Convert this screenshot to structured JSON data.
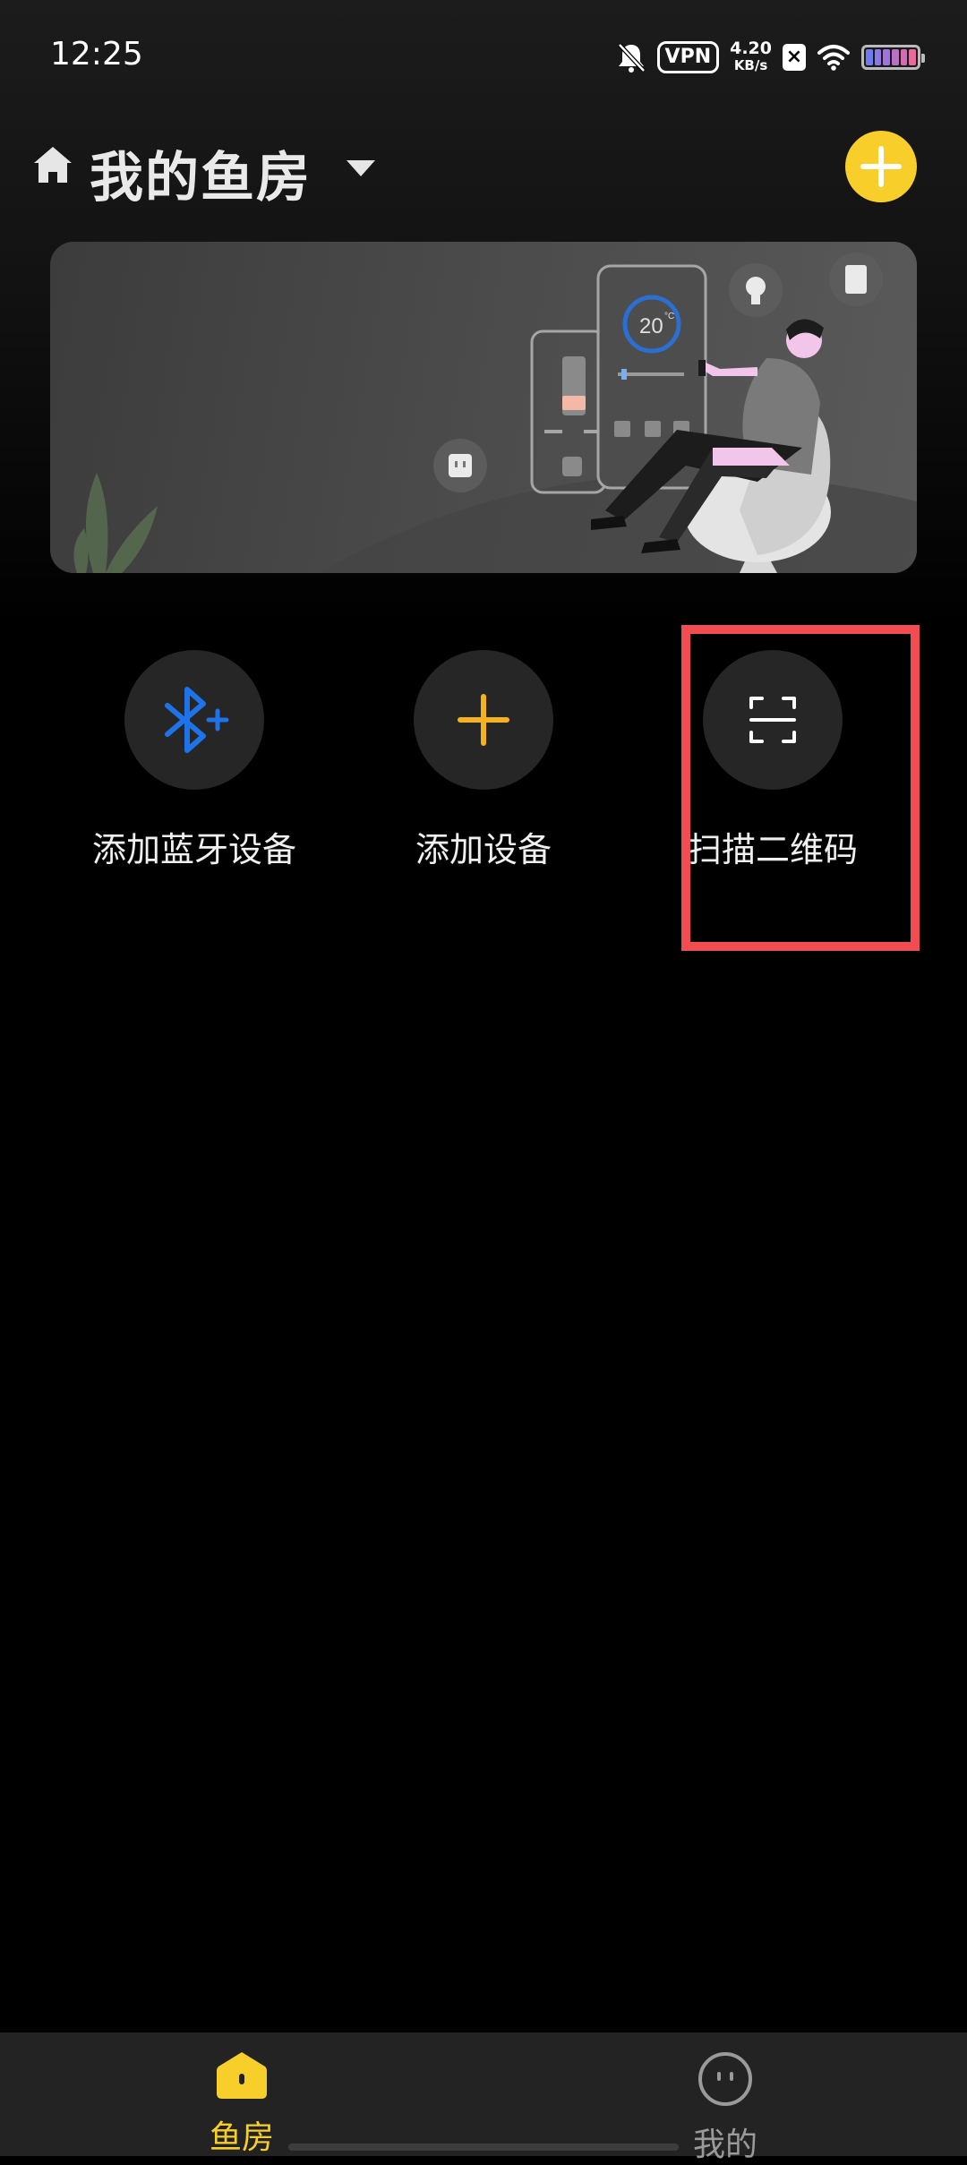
{
  "status_bar": {
    "time": "12:25",
    "vpn": "VPN",
    "speed_value": "4.20",
    "speed_unit": "KB/s",
    "icons": [
      "bell-muted-icon",
      "vpn-icon",
      "x-icon",
      "wifi-icon",
      "battery-icon"
    ]
  },
  "header": {
    "title": "我的鱼房",
    "icons": [
      "home-icon",
      "dropdown-arrow-icon",
      "plus-icon"
    ],
    "accent_color": "#f8cf2a"
  },
  "banner": {
    "thermostat_value": "20",
    "thermostat_unit": "°C"
  },
  "actions": [
    {
      "label": "添加蓝牙设备",
      "icon": "bluetooth-plus-icon",
      "color": "#1e73e8"
    },
    {
      "label": "添加设备",
      "icon": "plus-icon",
      "color": "#f5b21e"
    },
    {
      "label": "扫描二维码",
      "icon": "scan-qr-icon",
      "color": "#ffffff"
    }
  ],
  "highlight": {
    "color": "#ef4d4f",
    "target": "扫描二维码"
  },
  "bottom_nav": {
    "items": [
      {
        "label": "鱼房",
        "icon": "house-icon",
        "active": true,
        "color": "#f8cf2a"
      },
      {
        "label": "我的",
        "icon": "face-icon",
        "active": false,
        "color": "#9a9a9a"
      }
    ]
  }
}
